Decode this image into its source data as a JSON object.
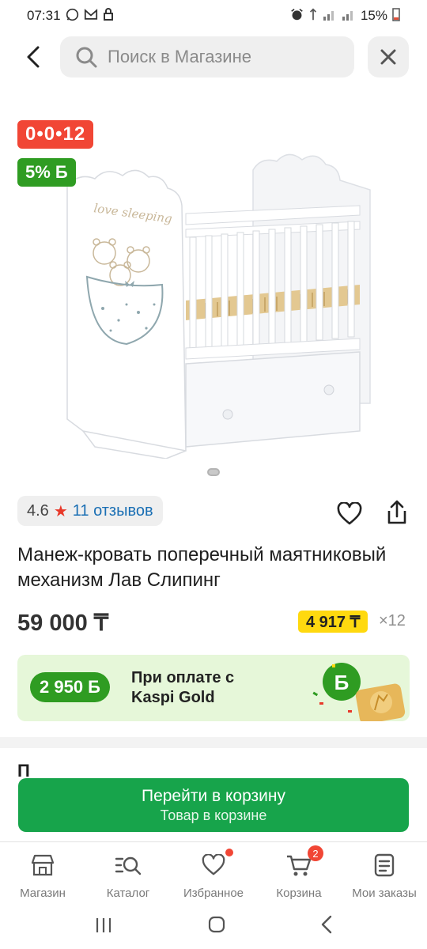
{
  "status_bar": {
    "time": "07:31",
    "battery": "15%",
    "left_icons": [
      "whatsapp-icon",
      "gmail-icon",
      "lock-icon"
    ],
    "right_icons": [
      "alarm-icon",
      "network-icon",
      "signal-icon",
      "signal-icon",
      "battery-icon"
    ]
  },
  "header": {
    "search_placeholder": "Поиск в Магазине"
  },
  "gallery": {
    "installment_badge": "0•0•12",
    "bonus_badge": "5% Б",
    "pages": 1,
    "active_page": 1
  },
  "rating": {
    "value": "4.6",
    "reviews": "11 отзывов"
  },
  "product": {
    "title": "Манеж-кровать поперечный маятниковый механизм Лав Слипинг",
    "price": "59 000 ₸",
    "monthly": "4 917 ₸",
    "monthly_mult": "×12"
  },
  "gold_banner": {
    "amount": "2 950 Б",
    "text": "При оплате с Kaspi Gold"
  },
  "section_peek": "П",
  "cart_button": {
    "label": "Перейти в корзину",
    "sublabel": "Товар в корзине"
  },
  "bottom_nav": {
    "items": [
      {
        "label": "Магазин"
      },
      {
        "label": "Каталог"
      },
      {
        "label": "Избранное"
      },
      {
        "label": "Корзина",
        "badge": "2"
      },
      {
        "label": "Мои заказы"
      }
    ]
  },
  "colors": {
    "accent_green": "#17a44b",
    "badge_red": "#f14635",
    "bonus_green": "#2f9c22",
    "monthly_yellow": "#ffd90f"
  }
}
